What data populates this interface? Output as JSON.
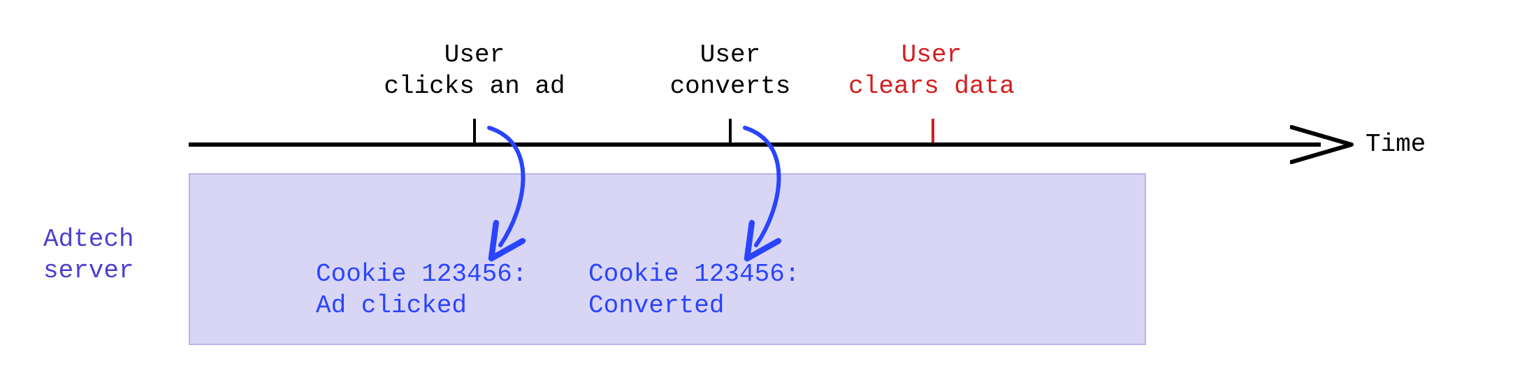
{
  "axis_label": "Time",
  "server_label": "Adtech\nserver",
  "events": [
    {
      "label": "User\nclicks an ad",
      "color": "#000000"
    },
    {
      "label": "User\nconverts",
      "color": "#000000"
    },
    {
      "label": "User\nclears data",
      "color": "#d21f1f"
    }
  ],
  "server_entries": [
    "Cookie 123456:\nAd clicked",
    "Cookie 123456:\nConverted"
  ],
  "chart_data": {
    "type": "timeline",
    "axis": "Time",
    "events": [
      {
        "name": "User clicks an ad",
        "server_record": "Cookie 123456: Ad clicked"
      },
      {
        "name": "User converts",
        "server_record": "Cookie 123456: Converted"
      },
      {
        "name": "User clears data",
        "highlight": "red"
      }
    ],
    "server": "Adtech server"
  }
}
